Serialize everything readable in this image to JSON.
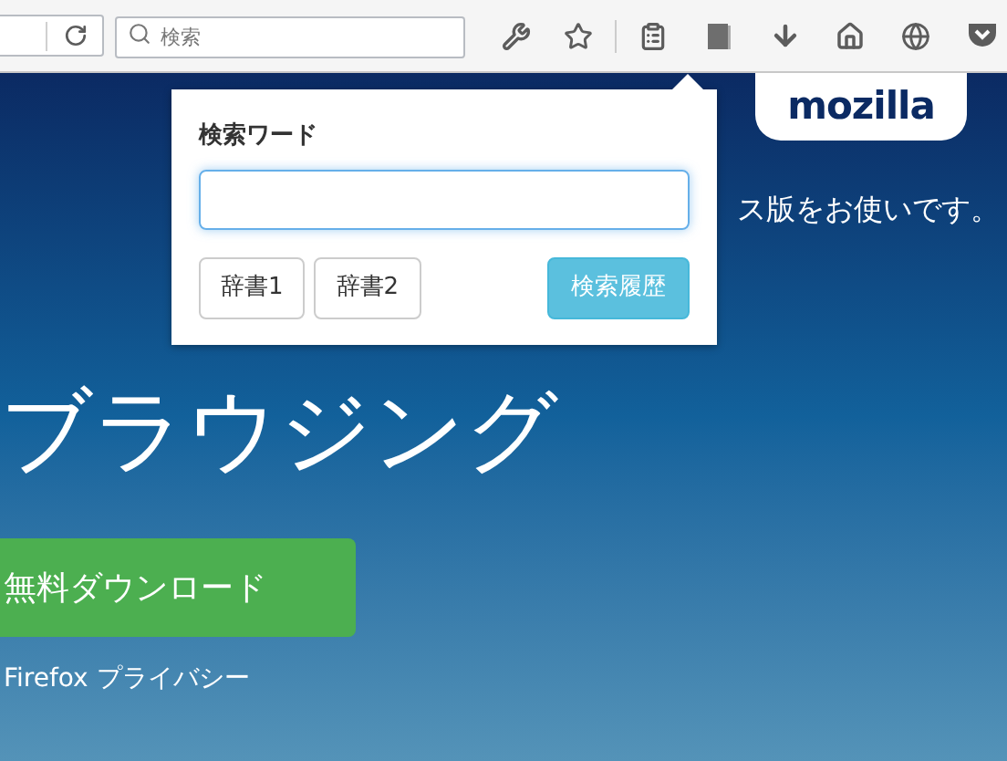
{
  "toolbar": {
    "search": {
      "placeholder": "検索"
    }
  },
  "popup": {
    "label": "検索ワード",
    "buttons": [
      {
        "label": "辞書1",
        "kind": "default"
      },
      {
        "label": "辞書2",
        "kind": "default"
      },
      {
        "label": "検索履歴",
        "kind": "primary"
      }
    ]
  },
  "page": {
    "logo": "mozilla",
    "notice": "ス版をお使いです。",
    "headline": "ブラウジング",
    "download_button": "無料ダウンロード",
    "privacy_link": "Firefox プライバシー"
  }
}
